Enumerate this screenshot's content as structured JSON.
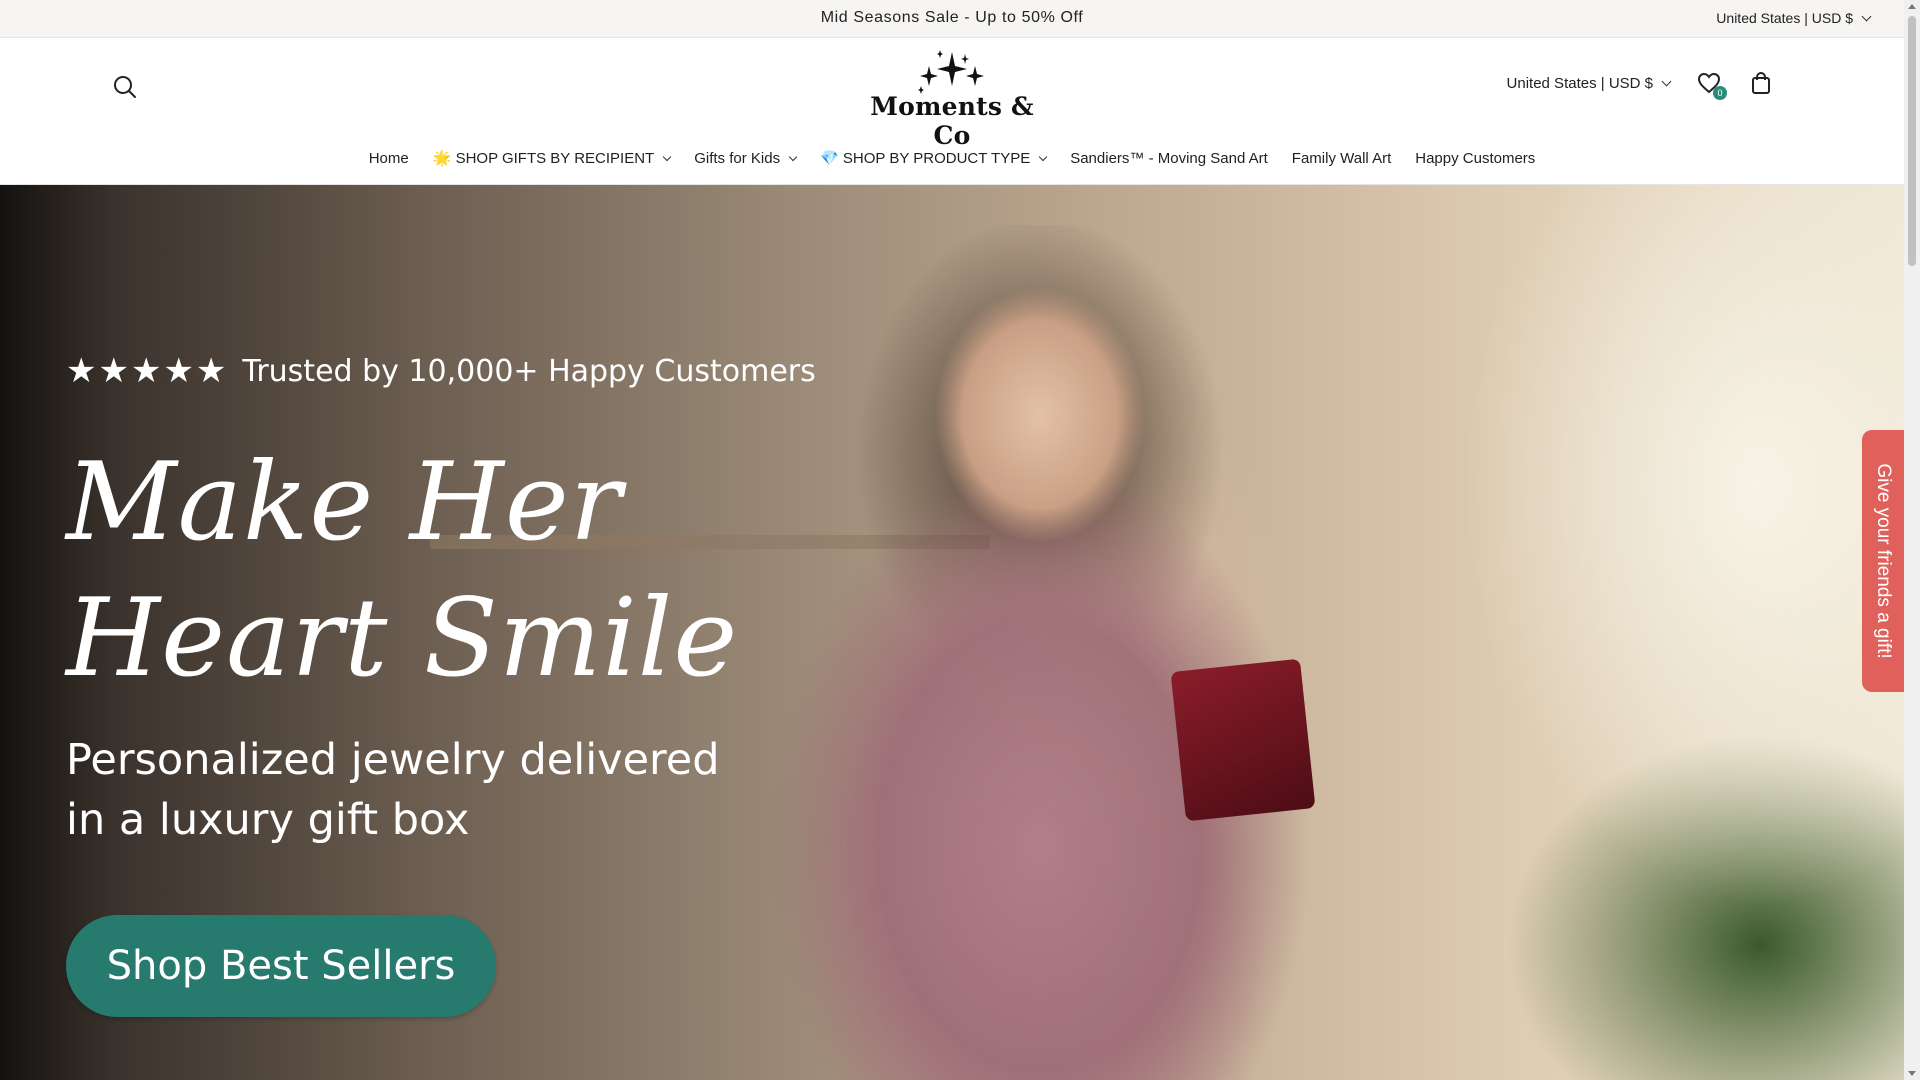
{
  "announcement": {
    "message": "Mid Seasons Sale - Up to 50% Off",
    "currency": "United States | USD $"
  },
  "header": {
    "logo_text": "Moments & Co",
    "currency": "United States | USD $",
    "wishlist_count": "0",
    "icons": [
      "search-icon",
      "wishlist-icon",
      "cart-icon"
    ]
  },
  "nav": {
    "items": [
      {
        "label": "Home"
      },
      {
        "label": "🌟 SHOP GIFTS BY RECIPIENT"
      },
      {
        "label": "Gifts for Kids"
      },
      {
        "label": "💎 SHOP BY PRODUCT TYPE"
      },
      {
        "label": "Sandiers™ - Moving Sand Art"
      },
      {
        "label": "Family Wall Art"
      },
      {
        "label": "Happy Customers"
      }
    ]
  },
  "hero": {
    "rating_stars": "★★★★★",
    "rating_text": "Trusted by 10,000+ Happy Customers",
    "headline_line1": "Make Her",
    "headline_line2": "Heart Smile",
    "subtitle_line1": "Personalized jewelry delivered",
    "subtitle_line2": "in a luxury gift box",
    "cta_label": "Shop Best Sellers"
  },
  "side_tab": {
    "label": "Give your friends a gift!"
  },
  "colors": {
    "cta": "#267a6e",
    "side_tab": "#e0615c",
    "badge": "#2a8b7a"
  }
}
